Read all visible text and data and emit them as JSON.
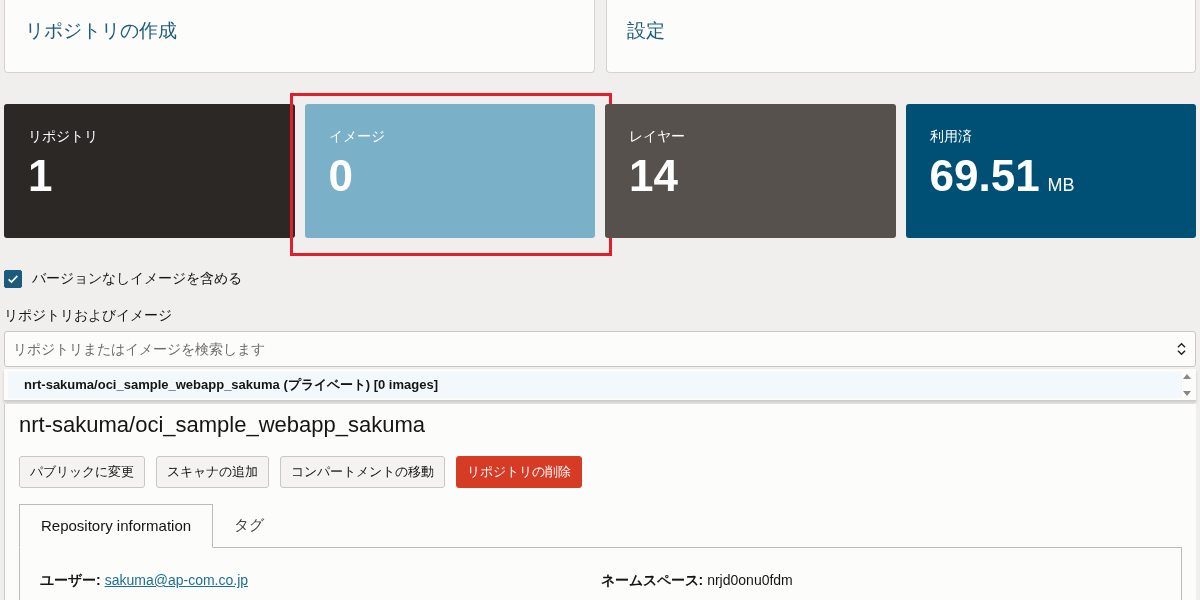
{
  "top_cards": [
    {
      "title": "リポジトリの作成"
    },
    {
      "title": "設定"
    }
  ],
  "stats": [
    {
      "label": "リポジトリ",
      "value": "1",
      "kind": "dark",
      "highlighted": false
    },
    {
      "label": "イメージ",
      "value": "0",
      "kind": "light",
      "highlighted": true
    },
    {
      "label": "レイヤー",
      "value": "14",
      "kind": "grey",
      "highlighted": false
    },
    {
      "label": "利用済",
      "value": "69.51",
      "unit": "MB",
      "kind": "blue",
      "highlighted": false
    }
  ],
  "include_unversioned": {
    "label": "バージョンなしイメージを含める",
    "checked": true
  },
  "search": {
    "label": "リポジトリおよびイメージ",
    "placeholder": "リポジトリまたはイメージを検索します"
  },
  "results": [
    {
      "text": "nrt-sakuma/oci_sample_webapp_sakuma (プライベート) [0 images]"
    }
  ],
  "detail": {
    "title": "nrt-sakuma/oci_sample_webapp_sakuma",
    "buttons": [
      {
        "label": "パブリックに変更",
        "kind": "default"
      },
      {
        "label": "スキャナの追加",
        "kind": "default"
      },
      {
        "label": "コンパートメントの移動",
        "kind": "default"
      },
      {
        "label": "リポジトリの削除",
        "kind": "danger"
      }
    ],
    "tabs": [
      {
        "label": "Repository information",
        "selected": true
      },
      {
        "label": "タグ",
        "selected": false
      }
    ],
    "fields": [
      {
        "label": "ユーザー:",
        "value": "sakuma@ap-com.co.jp",
        "kind": "link"
      },
      {
        "label": "ネームスペース:",
        "value": "nrjd0onu0fdm",
        "kind": "text"
      }
    ]
  }
}
